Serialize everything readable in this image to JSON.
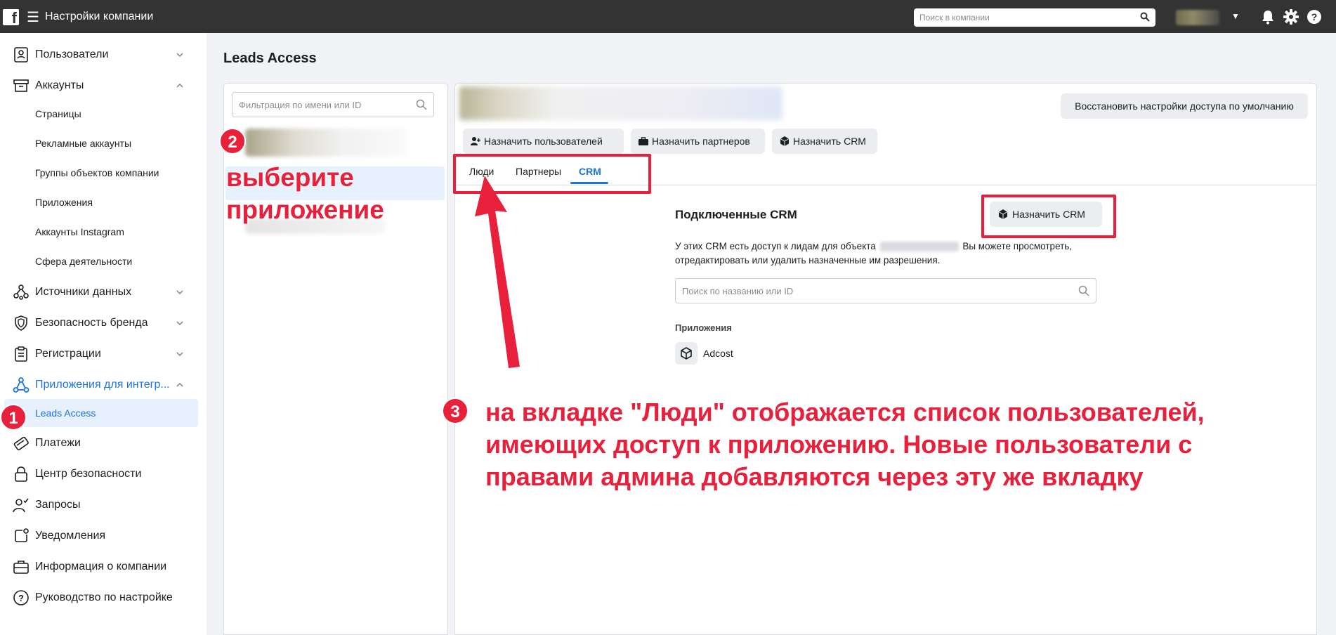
{
  "topbar": {
    "logo": "f",
    "title": "Настройки компании",
    "search_placeholder": "Поиск в компании"
  },
  "sidebar": {
    "items": [
      {
        "label": "Пользователи",
        "icon": "users-id-icon"
      },
      {
        "label": "Аккаунты",
        "icon": "archive-icon"
      },
      {
        "label": "Источники данных",
        "icon": "data-sources-icon"
      },
      {
        "label": "Безопасность бренда",
        "icon": "shield-icon"
      },
      {
        "label": "Регистрации",
        "icon": "clipboard-icon"
      },
      {
        "label": "Приложения для интегр...",
        "icon": "integrations-icon"
      },
      {
        "label": "Платежи",
        "icon": "payments-icon"
      },
      {
        "label": "Центр безопасности",
        "icon": "lock-icon"
      },
      {
        "label": "Запросы",
        "icon": "requests-icon"
      },
      {
        "label": "Уведомления",
        "icon": "notifications-icon"
      },
      {
        "label": "Информация о компании",
        "icon": "briefcase-icon"
      },
      {
        "label": "Руководство по настройке",
        "icon": "help-icon"
      }
    ],
    "accounts_sub": [
      "Страницы",
      "Рекламные аккаунты",
      "Группы объектов компании",
      "Приложения",
      "Аккаунты Instagram",
      "Сфера деятельности"
    ],
    "integrations_sub": [
      "Leads Access"
    ]
  },
  "main": {
    "title": "Leads Access",
    "filter_placeholder": "Фильтрация по имени или ID",
    "restore_button": "Восстановить настройки доступа по умолчанию",
    "assign_users": "Назначить пользователей",
    "assign_partners": "Назначить партнеров",
    "assign_crm": "Назначить CRM",
    "tabs": [
      "Люди",
      "Партнеры",
      "CRM"
    ],
    "crm": {
      "title": "Подключенные CRM",
      "assign_button": "Назначить CRM",
      "desc_part1": "У этих CRM есть доступ к лидам для объекта",
      "desc_part2": "Вы можете просмотреть, отредактировать или удалить назначенные им разрешения.",
      "search_placeholder": "Поиск по названию или ID",
      "apps_title": "Приложения",
      "app_name": "Adcost"
    }
  },
  "annotations": {
    "n1": "1",
    "n2": "2",
    "n3": "3",
    "choose_app_line1": "выберите",
    "choose_app_line2": "приложение",
    "note_line1": "на вкладке \"Люди\" отображается список пользователей,",
    "note_line2": "имеющих доступ к приложению. Новые пользователи с",
    "note_line3": "правами админа добавляются через эту же вкладку"
  },
  "colors": {
    "accent": "#1b74e4",
    "annotation": "#e8203b",
    "topbar": "#333333"
  }
}
